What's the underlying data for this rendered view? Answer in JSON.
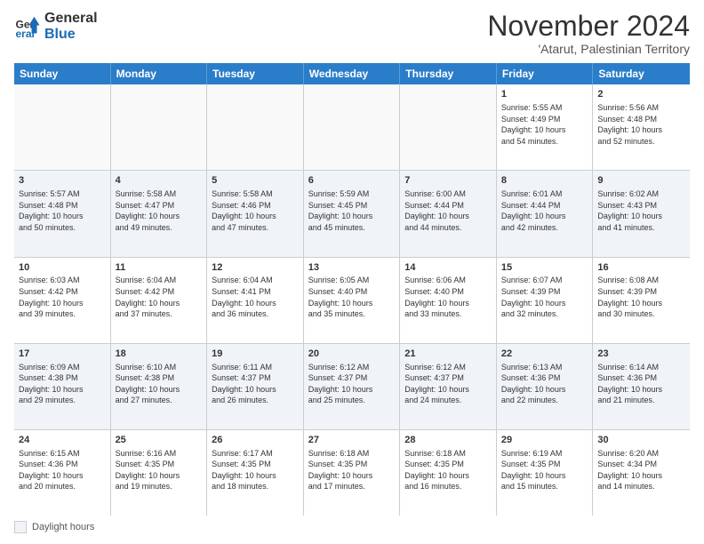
{
  "logo": {
    "general": "General",
    "blue": "Blue"
  },
  "title": "November 2024",
  "subtitle": "'Atarut, Palestinian Territory",
  "headers": [
    "Sunday",
    "Monday",
    "Tuesday",
    "Wednesday",
    "Thursday",
    "Friday",
    "Saturday"
  ],
  "legend": {
    "box_label": "Daylight hours"
  },
  "weeks": [
    {
      "alt": false,
      "days": [
        {
          "num": "",
          "info": ""
        },
        {
          "num": "",
          "info": ""
        },
        {
          "num": "",
          "info": ""
        },
        {
          "num": "",
          "info": ""
        },
        {
          "num": "",
          "info": ""
        },
        {
          "num": "1",
          "info": "Sunrise: 5:55 AM\nSunset: 4:49 PM\nDaylight: 10 hours\nand 54 minutes."
        },
        {
          "num": "2",
          "info": "Sunrise: 5:56 AM\nSunset: 4:48 PM\nDaylight: 10 hours\nand 52 minutes."
        }
      ]
    },
    {
      "alt": true,
      "days": [
        {
          "num": "3",
          "info": "Sunrise: 5:57 AM\nSunset: 4:48 PM\nDaylight: 10 hours\nand 50 minutes."
        },
        {
          "num": "4",
          "info": "Sunrise: 5:58 AM\nSunset: 4:47 PM\nDaylight: 10 hours\nand 49 minutes."
        },
        {
          "num": "5",
          "info": "Sunrise: 5:58 AM\nSunset: 4:46 PM\nDaylight: 10 hours\nand 47 minutes."
        },
        {
          "num": "6",
          "info": "Sunrise: 5:59 AM\nSunset: 4:45 PM\nDaylight: 10 hours\nand 45 minutes."
        },
        {
          "num": "7",
          "info": "Sunrise: 6:00 AM\nSunset: 4:44 PM\nDaylight: 10 hours\nand 44 minutes."
        },
        {
          "num": "8",
          "info": "Sunrise: 6:01 AM\nSunset: 4:44 PM\nDaylight: 10 hours\nand 42 minutes."
        },
        {
          "num": "9",
          "info": "Sunrise: 6:02 AM\nSunset: 4:43 PM\nDaylight: 10 hours\nand 41 minutes."
        }
      ]
    },
    {
      "alt": false,
      "days": [
        {
          "num": "10",
          "info": "Sunrise: 6:03 AM\nSunset: 4:42 PM\nDaylight: 10 hours\nand 39 minutes."
        },
        {
          "num": "11",
          "info": "Sunrise: 6:04 AM\nSunset: 4:42 PM\nDaylight: 10 hours\nand 37 minutes."
        },
        {
          "num": "12",
          "info": "Sunrise: 6:04 AM\nSunset: 4:41 PM\nDaylight: 10 hours\nand 36 minutes."
        },
        {
          "num": "13",
          "info": "Sunrise: 6:05 AM\nSunset: 4:40 PM\nDaylight: 10 hours\nand 35 minutes."
        },
        {
          "num": "14",
          "info": "Sunrise: 6:06 AM\nSunset: 4:40 PM\nDaylight: 10 hours\nand 33 minutes."
        },
        {
          "num": "15",
          "info": "Sunrise: 6:07 AM\nSunset: 4:39 PM\nDaylight: 10 hours\nand 32 minutes."
        },
        {
          "num": "16",
          "info": "Sunrise: 6:08 AM\nSunset: 4:39 PM\nDaylight: 10 hours\nand 30 minutes."
        }
      ]
    },
    {
      "alt": true,
      "days": [
        {
          "num": "17",
          "info": "Sunrise: 6:09 AM\nSunset: 4:38 PM\nDaylight: 10 hours\nand 29 minutes."
        },
        {
          "num": "18",
          "info": "Sunrise: 6:10 AM\nSunset: 4:38 PM\nDaylight: 10 hours\nand 27 minutes."
        },
        {
          "num": "19",
          "info": "Sunrise: 6:11 AM\nSunset: 4:37 PM\nDaylight: 10 hours\nand 26 minutes."
        },
        {
          "num": "20",
          "info": "Sunrise: 6:12 AM\nSunset: 4:37 PM\nDaylight: 10 hours\nand 25 minutes."
        },
        {
          "num": "21",
          "info": "Sunrise: 6:12 AM\nSunset: 4:37 PM\nDaylight: 10 hours\nand 24 minutes."
        },
        {
          "num": "22",
          "info": "Sunrise: 6:13 AM\nSunset: 4:36 PM\nDaylight: 10 hours\nand 22 minutes."
        },
        {
          "num": "23",
          "info": "Sunrise: 6:14 AM\nSunset: 4:36 PM\nDaylight: 10 hours\nand 21 minutes."
        }
      ]
    },
    {
      "alt": false,
      "days": [
        {
          "num": "24",
          "info": "Sunrise: 6:15 AM\nSunset: 4:36 PM\nDaylight: 10 hours\nand 20 minutes."
        },
        {
          "num": "25",
          "info": "Sunrise: 6:16 AM\nSunset: 4:35 PM\nDaylight: 10 hours\nand 19 minutes."
        },
        {
          "num": "26",
          "info": "Sunrise: 6:17 AM\nSunset: 4:35 PM\nDaylight: 10 hours\nand 18 minutes."
        },
        {
          "num": "27",
          "info": "Sunrise: 6:18 AM\nSunset: 4:35 PM\nDaylight: 10 hours\nand 17 minutes."
        },
        {
          "num": "28",
          "info": "Sunrise: 6:18 AM\nSunset: 4:35 PM\nDaylight: 10 hours\nand 16 minutes."
        },
        {
          "num": "29",
          "info": "Sunrise: 6:19 AM\nSunset: 4:35 PM\nDaylight: 10 hours\nand 15 minutes."
        },
        {
          "num": "30",
          "info": "Sunrise: 6:20 AM\nSunset: 4:34 PM\nDaylight: 10 hours\nand 14 minutes."
        }
      ]
    }
  ]
}
